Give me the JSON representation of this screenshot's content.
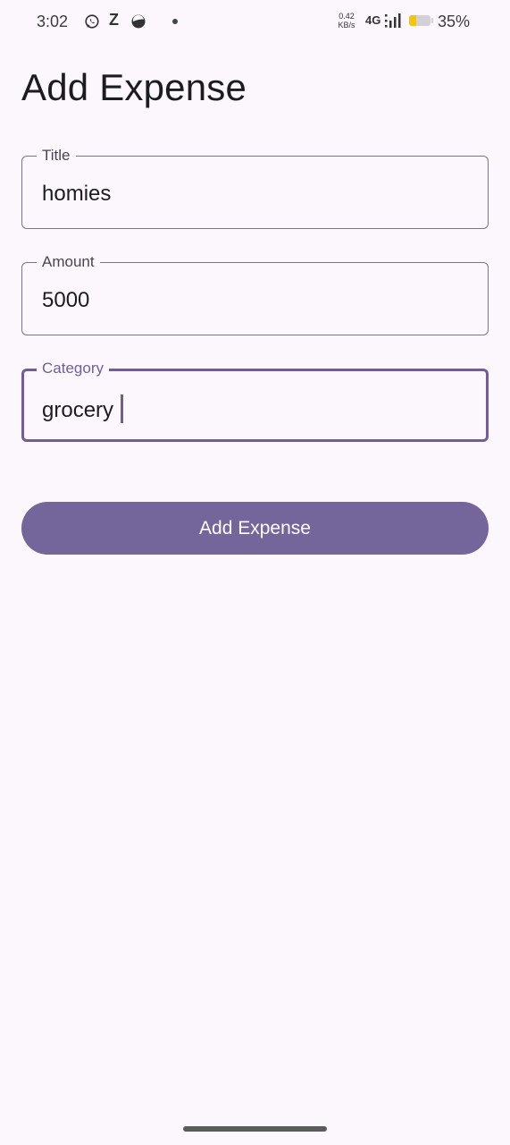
{
  "status_bar": {
    "time": "3:02",
    "net_speed_value": "0.42",
    "net_speed_unit": "KB/s",
    "network": "4G",
    "battery_percent": "35%",
    "battery_level": 0.35,
    "icons": [
      "whatsapp-icon",
      "z-app-icon",
      "moon-app-icon",
      "notification-dot-icon",
      "signal-icon",
      "battery-icon"
    ],
    "z_glyph": "Z"
  },
  "page": {
    "title": "Add Expense"
  },
  "form": {
    "title_field": {
      "label": "Title",
      "value": "homies"
    },
    "amount_field": {
      "label": "Amount",
      "value": "5000"
    },
    "category_field": {
      "label": "Category",
      "value": "grocery",
      "focused": true
    }
  },
  "actions": {
    "submit_label": "Add Expense"
  },
  "colors": {
    "background": "#fcf7fd",
    "accent": "#74659a",
    "focus_border": "#6f5f95",
    "outline": "#7a757f",
    "battery": "#f2c511"
  }
}
